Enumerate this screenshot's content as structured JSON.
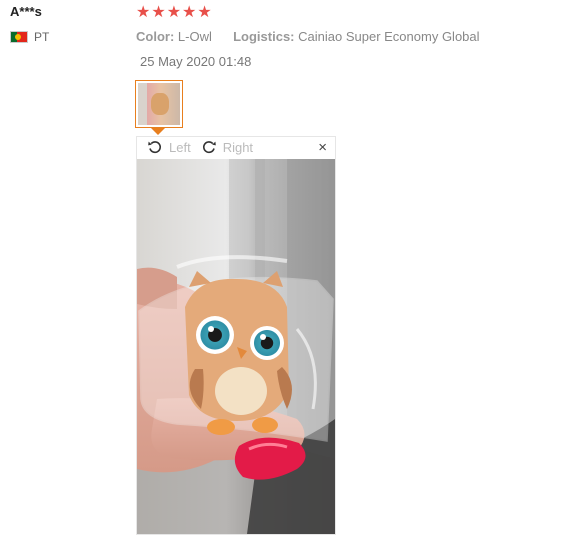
{
  "review": {
    "reviewer_name": "A***s",
    "country_code": "PT",
    "rating": 5,
    "stars": [
      "★",
      "★",
      "★",
      "★",
      "★"
    ],
    "color_label": "Color:",
    "color_value": "L-Owl",
    "logistics_label": "Logistics:",
    "logistics_value": "Cainiao Super Economy Global",
    "date": "25 May 2020 01:48"
  },
  "viewer": {
    "rotate_left_label": "Left",
    "rotate_right_label": "Right",
    "close_symbol": "×"
  },
  "colors": {
    "star": "#e8504a",
    "thumb_border": "#e87f1e"
  }
}
